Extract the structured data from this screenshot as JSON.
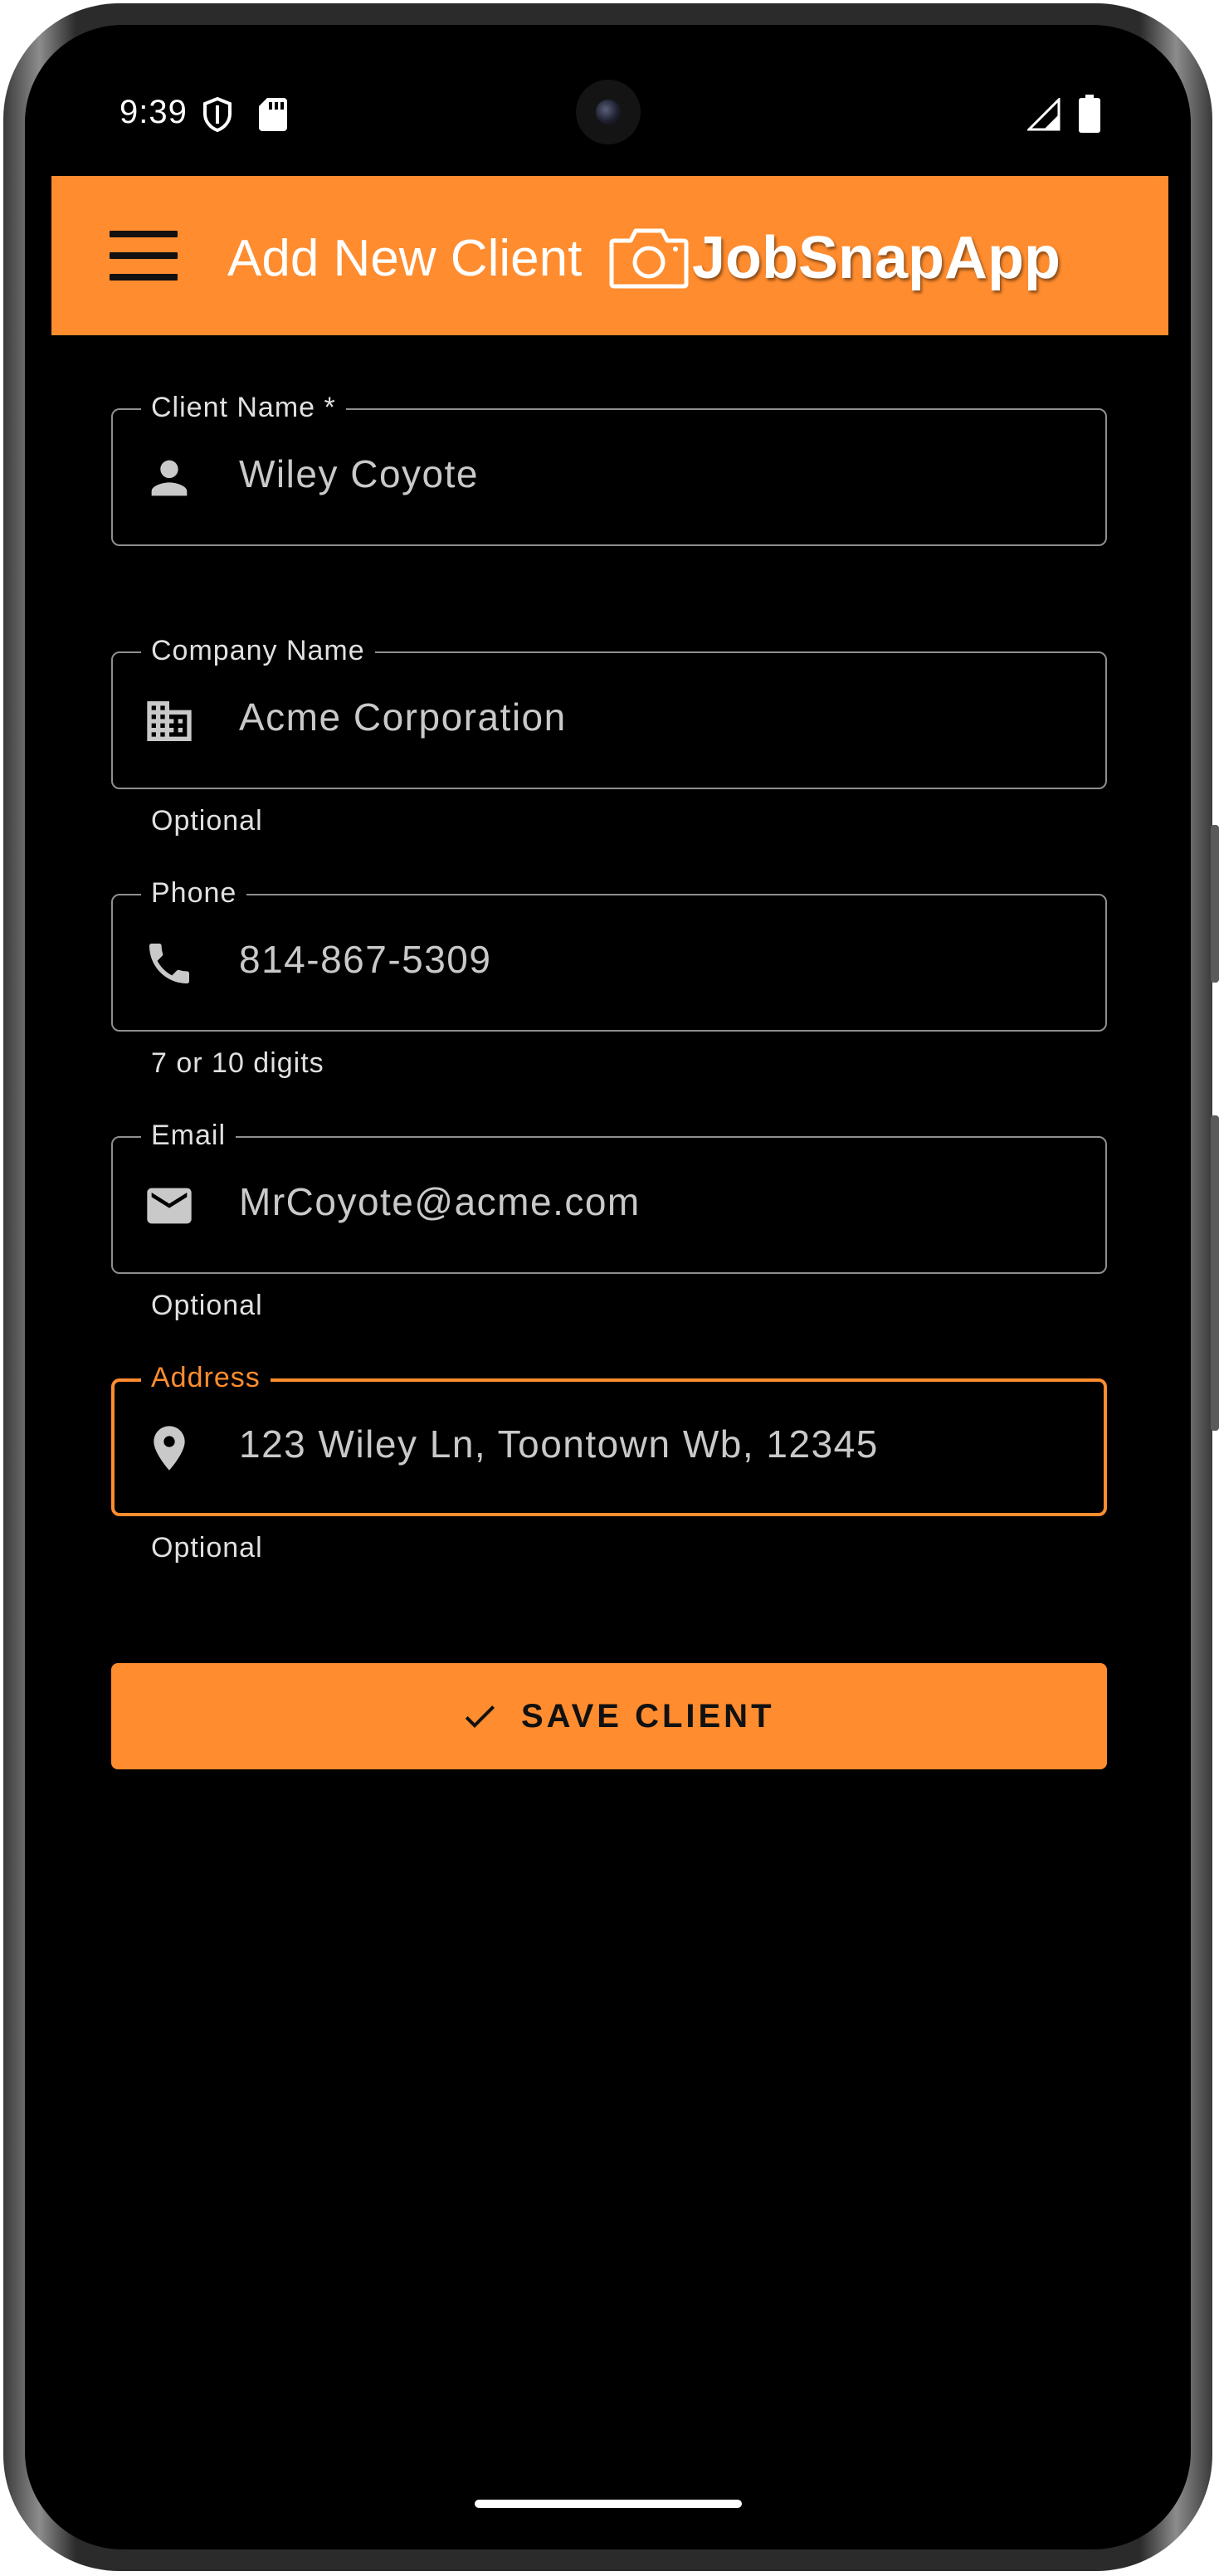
{
  "status_bar": {
    "time": "9:39",
    "left_icons": [
      "shield-icon",
      "sd-card-icon"
    ],
    "right_icons": [
      "cell-signal-icon",
      "battery-icon"
    ]
  },
  "app_bar": {
    "title": "Add New Client",
    "brand": "JobSnapApp",
    "color": "#ff8c2e"
  },
  "form": {
    "client_name": {
      "label": "Client Name *",
      "value": "Wiley Coyote",
      "icon": "person-icon"
    },
    "company_name": {
      "label": "Company Name",
      "value": "Acme Corporation",
      "helper": "Optional",
      "icon": "building-icon"
    },
    "phone": {
      "label": "Phone",
      "value": "814-867-5309",
      "helper": "7 or 10 digits",
      "icon": "phone-icon"
    },
    "email": {
      "label": "Email",
      "value": "MrCoyote@acme.com",
      "helper": "Optional",
      "icon": "mail-icon"
    },
    "address": {
      "label": "Address",
      "value": "123 Wiley Ln, Toontown Wb, 12345",
      "helper": "Optional",
      "icon": "location-pin-icon",
      "focused": true
    }
  },
  "save_button": {
    "label": "SAVE CLIENT",
    "icon": "check-icon"
  },
  "colors": {
    "accent": "#ff8c2e",
    "background": "#000000",
    "outline": "#8f8f8f",
    "text_value": "#c9c9c9"
  }
}
